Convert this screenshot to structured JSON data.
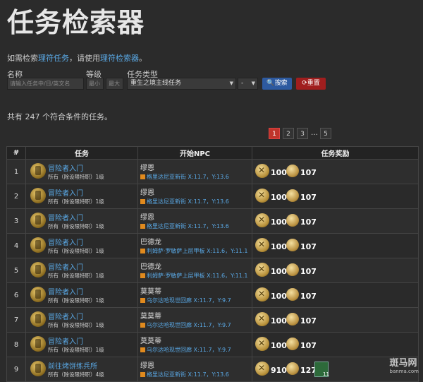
{
  "page": {
    "title": "任务检索器",
    "intro_prefix": "如需检索",
    "intro_link1": "理符任务",
    "intro_mid": "，请使用",
    "intro_link2": "理符检索器",
    "intro_suffix": "。"
  },
  "form": {
    "name_label": "名称",
    "name_placeholder": "请输入任务中/日/英文名",
    "level_label": "等级",
    "level_min_placeholder": "最小",
    "level_max_placeholder": "最大",
    "type_label": "任务类型",
    "type_value": "重生之境主线任务",
    "sub_value": "-",
    "search_label": "搜索",
    "reset_label": "重置"
  },
  "result_count": "共有 247 个符合条件的任务。",
  "pagination": {
    "pages": [
      "1",
      "2",
      "3",
      "5"
    ],
    "dots": "…",
    "active": "1"
  },
  "table": {
    "headers": [
      "#",
      "任务",
      "开始NPC",
      "任务奖励"
    ],
    "rows": [
      {
        "num": "1",
        "quest": "冒险者入门",
        "req": "所有（除设限特职）1级",
        "npc": "缪恩",
        "loc": "格里达尼亚新街 X:11.7，Y:13.6",
        "exp": "100",
        "gil": "107"
      },
      {
        "num": "2",
        "quest": "冒险者入门",
        "req": "所有（除设限特职）1级",
        "npc": "缪恩",
        "loc": "格里达尼亚新街 X:11.7，Y:13.6",
        "exp": "100",
        "gil": "107"
      },
      {
        "num": "3",
        "quest": "冒险者入门",
        "req": "所有（除设限特职）1级",
        "npc": "缪恩",
        "loc": "格里达尼亚新街 X:11.7，Y:13.6",
        "exp": "100",
        "gil": "107"
      },
      {
        "num": "4",
        "quest": "冒险者入门",
        "req": "所有（除设限特职）1级",
        "npc": "巴德龙",
        "loc": "利姆萨·罗敏萨上层甲板 X:11.6，Y:11.1",
        "exp": "100",
        "gil": "107"
      },
      {
        "num": "5",
        "quest": "冒险者入门",
        "req": "所有（除设限特职）1级",
        "npc": "巴德龙",
        "loc": "利姆萨·罗敏萨上层甲板 X:11.6，Y:11.1",
        "exp": "100",
        "gil": "107"
      },
      {
        "num": "6",
        "quest": "冒险者入门",
        "req": "所有（除设限特职）1级",
        "npc": "莫莫蒂",
        "loc": "乌尔达哈现世回廊 X:11.7，Y:9.7",
        "exp": "100",
        "gil": "107"
      },
      {
        "num": "7",
        "quest": "冒险者入门",
        "req": "所有（除设限特职）1级",
        "npc": "莫莫蒂",
        "loc": "乌尔达哈现世回廊 X:11.7，Y:9.7",
        "exp": "100",
        "gil": "107"
      },
      {
        "num": "8",
        "quest": "冒险者入门",
        "req": "所有（除设限特职）1级",
        "npc": "莫莫蒂",
        "loc": "乌尔达哈现世回廊 X:11.7，Y:9.7",
        "exp": "100",
        "gil": "107"
      },
      {
        "num": "9",
        "quest": "前往烤饼练兵所",
        "req": "所有（除设限特职）4级",
        "npc": "缪恩",
        "loc": "格里达尼亚新街 X:11.7，Y:13.6",
        "exp": "910",
        "gil": "127",
        "item": "11"
      }
    ]
  },
  "watermark": {
    "text": "斑马网",
    "sub": "banma.com"
  },
  "colors": {
    "link": "#5aa9e6",
    "search_button": "#2d5aa0",
    "reset_button": "#a01e1e",
    "active_page": "#c0342b"
  }
}
